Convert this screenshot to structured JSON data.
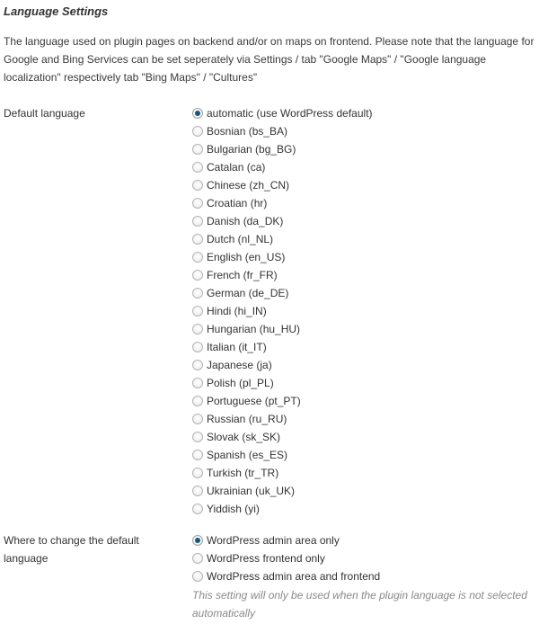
{
  "section": {
    "heading": "Language Settings",
    "description": "The language used on plugin pages on backend and/or on maps on frontend. Please note that the language for Google and Bing Services can be set seperately via Settings / tab \"Google Maps\" / \"Google language localization\" respectively tab \"Bing Maps\" / \"Cultures\""
  },
  "colors": {
    "text": "#333333",
    "note": "#8a8a8a",
    "radio_selected_dot": "#15577f",
    "radio_border": "#b5b5b5",
    "background": "#ffffff"
  },
  "fields": [
    {
      "name": "default-language",
      "label": "Default language",
      "options": [
        {
          "label": "automatic (use WordPress default)",
          "selected": true
        },
        {
          "label": "Bosnian (bs_BA)",
          "selected": false
        },
        {
          "label": "Bulgarian (bg_BG)",
          "selected": false
        },
        {
          "label": "Catalan (ca)",
          "selected": false
        },
        {
          "label": "Chinese (zh_CN)",
          "selected": false
        },
        {
          "label": "Croatian (hr)",
          "selected": false
        },
        {
          "label": "Danish (da_DK)",
          "selected": false
        },
        {
          "label": "Dutch (nl_NL)",
          "selected": false
        },
        {
          "label": "English (en_US)",
          "selected": false
        },
        {
          "label": "French (fr_FR)",
          "selected": false
        },
        {
          "label": "German (de_DE)",
          "selected": false
        },
        {
          "label": "Hindi (hi_IN)",
          "selected": false
        },
        {
          "label": "Hungarian (hu_HU)",
          "selected": false
        },
        {
          "label": "Italian (it_IT)",
          "selected": false
        },
        {
          "label": "Japanese (ja)",
          "selected": false
        },
        {
          "label": "Polish (pl_PL)",
          "selected": false
        },
        {
          "label": "Portuguese (pt_PT)",
          "selected": false
        },
        {
          "label": "Russian (ru_RU)",
          "selected": false
        },
        {
          "label": "Slovak (sk_SK)",
          "selected": false
        },
        {
          "label": "Spanish (es_ES)",
          "selected": false
        },
        {
          "label": "Turkish (tr_TR)",
          "selected": false
        },
        {
          "label": "Ukrainian (uk_UK)",
          "selected": false
        },
        {
          "label": "Yiddish (yi)",
          "selected": false
        }
      ],
      "note": ""
    },
    {
      "name": "where-to-change-default-language",
      "label": "Where to change the default language",
      "options": [
        {
          "label": "WordPress admin area only",
          "selected": true
        },
        {
          "label": "WordPress frontend only",
          "selected": false
        },
        {
          "label": "WordPress admin area and frontend",
          "selected": false
        }
      ],
      "note": "This setting will only be used when the plugin language is not selected automatically"
    }
  ]
}
